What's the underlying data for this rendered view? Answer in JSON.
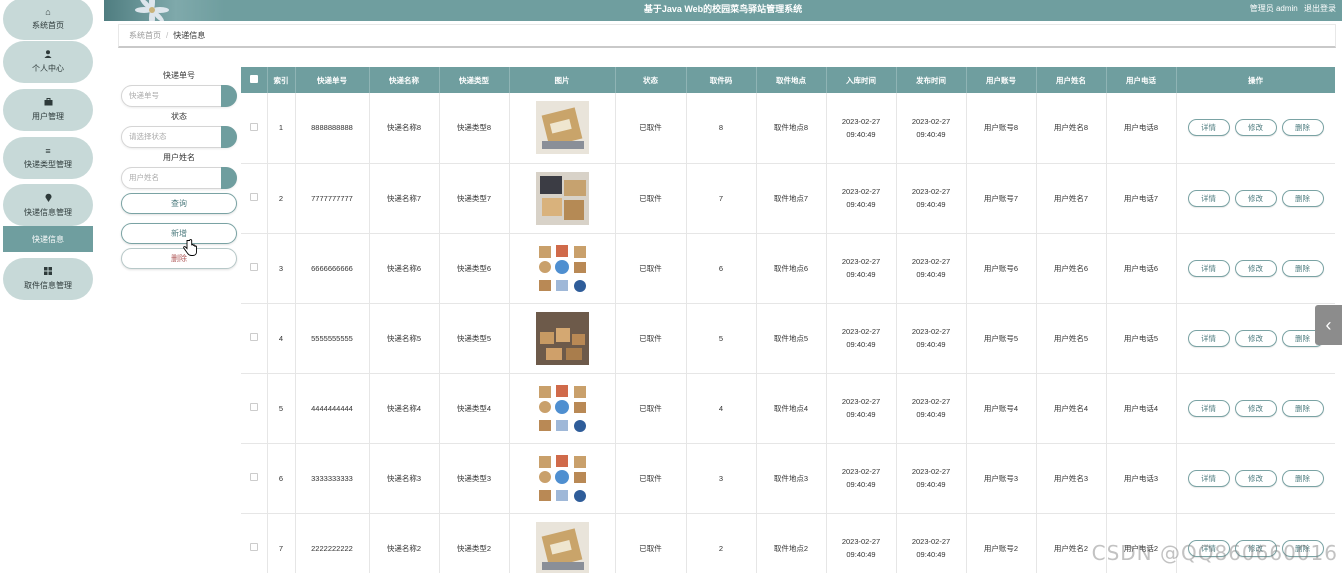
{
  "header": {
    "title": "基于Java Web的校园菜鸟驿站管理系统",
    "user": "管理员 admin",
    "logout": "退出登录"
  },
  "nav": {
    "items": [
      {
        "label": "系统首页",
        "icon": "home-icon"
      },
      {
        "label": "个人中心",
        "icon": "user-icon"
      },
      {
        "label": "用户管理",
        "icon": "briefcase-icon"
      },
      {
        "label": "快递类型管理",
        "icon": "sliders-icon"
      },
      {
        "label": "快递信息管理",
        "icon": "pin-icon"
      },
      {
        "label": "取件信息管理",
        "icon": "grid-icon"
      }
    ],
    "sub_active": "快递信息"
  },
  "breadcrumb": {
    "home": "系统首页",
    "sep": "/",
    "current": "快递信息"
  },
  "search": {
    "field1_label": "快递单号",
    "field1_placeholder": "快递单号",
    "field2_label": "状态",
    "field2_placeholder": "请选择状态",
    "field3_label": "用户姓名",
    "field3_placeholder": "用户姓名",
    "query_label": "查询",
    "add_label": "新增",
    "delete_label": "删除"
  },
  "table": {
    "columns": [
      "索引",
      "快递单号",
      "快递名称",
      "快递类型",
      "图片",
      "状态",
      "取件码",
      "取件地点",
      "入库时间",
      "发布时间",
      "用户账号",
      "用户姓名",
      "用户电话",
      "操作"
    ],
    "actions": {
      "detail": "详情",
      "edit": "修改",
      "delete": "删除"
    },
    "rows": [
      {
        "index": "1",
        "no": "8888888888",
        "name": "快递名称8",
        "type": "快递类型8",
        "image": "package-photo",
        "status": "已取件",
        "code": "8",
        "place": "取件地点8",
        "in_time": "2023-02-27 09:40:49",
        "pub_time": "2023-02-27 09:40:49",
        "account": "用户账号8",
        "uname": "用户姓名8",
        "phone": "用户电话8"
      },
      {
        "index": "2",
        "no": "7777777777",
        "name": "快递名称7",
        "type": "快递类型7",
        "image": "boxes-photo",
        "status": "已取件",
        "code": "7",
        "place": "取件地点7",
        "in_time": "2023-02-27 09:40:49",
        "pub_time": "2023-02-27 09:40:49",
        "account": "用户账号7",
        "uname": "用户姓名7",
        "phone": "用户电话7"
      },
      {
        "index": "3",
        "no": "6666666666",
        "name": "快递名称6",
        "type": "快递类型6",
        "image": "icon-grid",
        "status": "已取件",
        "code": "6",
        "place": "取件地点6",
        "in_time": "2023-02-27 09:40:49",
        "pub_time": "2023-02-27 09:40:49",
        "account": "用户账号6",
        "uname": "用户姓名6",
        "phone": "用户电话6"
      },
      {
        "index": "4",
        "no": "5555555555",
        "name": "快递名称5",
        "type": "快递类型5",
        "image": "warehouse-photo",
        "status": "已取件",
        "code": "5",
        "place": "取件地点5",
        "in_time": "2023-02-27 09:40:49",
        "pub_time": "2023-02-27 09:40:49",
        "account": "用户账号5",
        "uname": "用户姓名5",
        "phone": "用户电话5"
      },
      {
        "index": "5",
        "no": "4444444444",
        "name": "快递名称4",
        "type": "快递类型4",
        "image": "icon-grid",
        "status": "已取件",
        "code": "4",
        "place": "取件地点4",
        "in_time": "2023-02-27 09:40:49",
        "pub_time": "2023-02-27 09:40:49",
        "account": "用户账号4",
        "uname": "用户姓名4",
        "phone": "用户电话4"
      },
      {
        "index": "6",
        "no": "3333333333",
        "name": "快递名称3",
        "type": "快递类型3",
        "image": "icon-grid",
        "status": "已取件",
        "code": "3",
        "place": "取件地点3",
        "in_time": "2023-02-27 09:40:49",
        "pub_time": "2023-02-27 09:40:49",
        "account": "用户账号3",
        "uname": "用户姓名3",
        "phone": "用户电话3"
      },
      {
        "index": "7",
        "no": "2222222222",
        "name": "快递名称2",
        "type": "快递类型2",
        "image": "package-photo",
        "status": "已取件",
        "code": "2",
        "place": "取件地点2",
        "in_time": "2023-02-27 09:40:49",
        "pub_time": "2023-02-27 09:40:49",
        "account": "用户账号2",
        "uname": "用户姓名2",
        "phone": "用户电话2"
      }
    ]
  },
  "watermark": "CSDN @QQ860660016",
  "colors": {
    "accent": "#6f9e9f",
    "nav_pill": "#c7d9d8"
  }
}
